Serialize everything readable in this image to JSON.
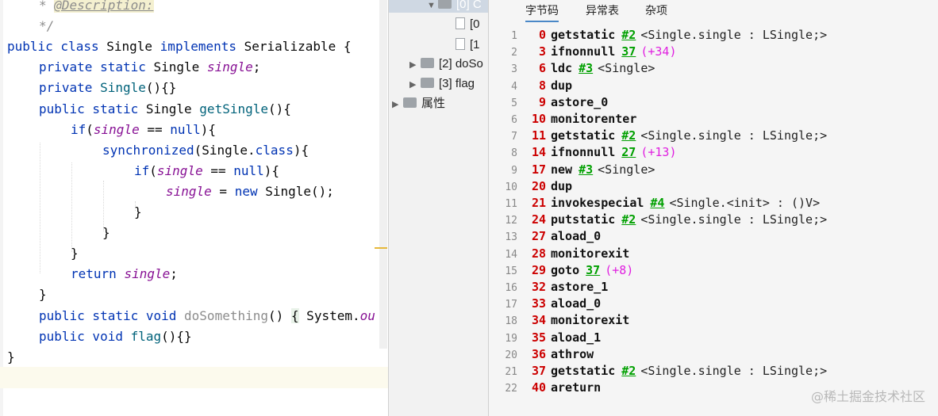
{
  "editor": {
    "lines": [
      {
        "indent": 1,
        "tokens": [
          [
            "cmt",
            "* "
          ],
          [
            "tag",
            "@Description:"
          ]
        ]
      },
      {
        "indent": 1,
        "tokens": [
          [
            "cmt",
            "*/"
          ]
        ]
      },
      {
        "indent": 0,
        "tokens": [
          [
            "kw",
            "public class "
          ],
          [
            "plain",
            "Single "
          ],
          [
            "kw",
            "implements "
          ],
          [
            "plain",
            "Serializable {"
          ]
        ]
      },
      {
        "indent": 1,
        "tokens": [
          [
            "kw",
            "private static "
          ],
          [
            "plain",
            "Single "
          ],
          [
            "fld",
            "single"
          ],
          [
            "plain",
            ";"
          ]
        ]
      },
      {
        "indent": 1,
        "tokens": [
          [
            "kw",
            "private "
          ],
          [
            "mth",
            "Single"
          ],
          [
            "plain",
            "(){}"
          ]
        ]
      },
      {
        "indent": 1,
        "tokens": [
          [
            "kw",
            "public static "
          ],
          [
            "plain",
            "Single "
          ],
          [
            "mth",
            "getSingle"
          ],
          [
            "plain",
            "(){"
          ]
        ]
      },
      {
        "indent": 2,
        "tokens": [
          [
            "kw",
            "if"
          ],
          [
            "plain",
            "("
          ],
          [
            "fld",
            "single"
          ],
          [
            "plain",
            " == "
          ],
          [
            "kw",
            "null"
          ],
          [
            "plain",
            "){"
          ]
        ]
      },
      {
        "indent": 3,
        "tokens": [
          [
            "kw",
            "synchronized"
          ],
          [
            "plain",
            "(Single."
          ],
          [
            "kw",
            "class"
          ],
          [
            "plain",
            "){"
          ]
        ]
      },
      {
        "indent": 4,
        "tokens": [
          [
            "kw",
            "if"
          ],
          [
            "plain",
            "("
          ],
          [
            "fld",
            "single"
          ],
          [
            "plain",
            " == "
          ],
          [
            "kw",
            "null"
          ],
          [
            "plain",
            "){"
          ]
        ]
      },
      {
        "indent": 5,
        "tokens": [
          [
            "fld",
            "single"
          ],
          [
            "plain",
            " = "
          ],
          [
            "kw",
            "new "
          ],
          [
            "plain",
            "Single();"
          ]
        ]
      },
      {
        "indent": 4,
        "tokens": [
          [
            "plain",
            "}"
          ]
        ]
      },
      {
        "indent": 3,
        "tokens": [
          [
            "plain",
            "}"
          ]
        ]
      },
      {
        "indent": 2,
        "tokens": [
          [
            "plain",
            "}"
          ]
        ]
      },
      {
        "indent": 2,
        "tokens": [
          [
            "kw",
            "return "
          ],
          [
            "fld",
            "single"
          ],
          [
            "plain",
            ";"
          ]
        ]
      },
      {
        "indent": 1,
        "tokens": [
          [
            "plain",
            "}"
          ]
        ]
      },
      {
        "indent": 1,
        "tokens": [
          [
            "kw",
            "public static void "
          ],
          [
            "dim",
            "doSomething"
          ],
          [
            "plain",
            "() "
          ],
          [
            "fold",
            "{"
          ],
          [
            "plain",
            " System."
          ],
          [
            "fld",
            "ou"
          ]
        ]
      },
      {
        "indent": 1,
        "tokens": [
          [
            "kw",
            "public void "
          ],
          [
            "mth",
            "flag"
          ],
          [
            "plain",
            "(){}"
          ]
        ]
      },
      {
        "indent": 0,
        "tokens": [
          [
            "plain",
            "}"
          ]
        ]
      }
    ]
  },
  "tree": {
    "rows": [
      {
        "kind": "folder",
        "arrow": "▼",
        "label": "[0] C",
        "depth": 2,
        "selected": true
      },
      {
        "kind": "file",
        "arrow": "",
        "label": "[0",
        "depth": 3
      },
      {
        "kind": "file",
        "arrow": "",
        "label": "[1",
        "depth": 3
      },
      {
        "kind": "folder",
        "arrow": "▶",
        "label": "[2] doSo",
        "depth": 1
      },
      {
        "kind": "folder",
        "arrow": "▶",
        "label": "[3] flag",
        "depth": 1
      },
      {
        "kind": "folder",
        "arrow": "▶",
        "label": "属性",
        "depth": 0
      }
    ]
  },
  "bytecode": {
    "tabs": [
      "字节码",
      "异常表",
      "杂项"
    ],
    "active_tab": 0,
    "lines": [
      {
        "n": "1",
        "off": "0",
        "op": "getstatic",
        "ref": "#2",
        "desc": "<Single.single : LSingle;>"
      },
      {
        "n": "2",
        "off": "3",
        "op": "ifnonnull",
        "ref": "37",
        "rel": "(+34)"
      },
      {
        "n": "3",
        "off": "6",
        "op": "ldc",
        "ref": "#3",
        "desc": "<Single>"
      },
      {
        "n": "4",
        "off": "8",
        "op": "dup"
      },
      {
        "n": "5",
        "off": "9",
        "op": "astore_0"
      },
      {
        "n": "6",
        "off": "10",
        "op": "monitorenter"
      },
      {
        "n": "7",
        "off": "11",
        "op": "getstatic",
        "ref": "#2",
        "desc": "<Single.single : LSingle;>"
      },
      {
        "n": "8",
        "off": "14",
        "op": "ifnonnull",
        "ref": "27",
        "rel": "(+13)"
      },
      {
        "n": "9",
        "off": "17",
        "op": "new",
        "ref": "#3",
        "desc": "<Single>"
      },
      {
        "n": "10",
        "off": "20",
        "op": "dup"
      },
      {
        "n": "11",
        "off": "21",
        "op": "invokespecial",
        "ref": "#4",
        "desc": "<Single.<init> : ()V>"
      },
      {
        "n": "12",
        "off": "24",
        "op": "putstatic",
        "ref": "#2",
        "desc": "<Single.single : LSingle;>"
      },
      {
        "n": "13",
        "off": "27",
        "op": "aload_0"
      },
      {
        "n": "14",
        "off": "28",
        "op": "monitorexit"
      },
      {
        "n": "15",
        "off": "29",
        "op": "goto",
        "ref": "37",
        "rel": "(+8)"
      },
      {
        "n": "16",
        "off": "32",
        "op": "astore_1"
      },
      {
        "n": "17",
        "off": "33",
        "op": "aload_0"
      },
      {
        "n": "18",
        "off": "34",
        "op": "monitorexit"
      },
      {
        "n": "19",
        "off": "35",
        "op": "aload_1"
      },
      {
        "n": "20",
        "off": "36",
        "op": "athrow"
      },
      {
        "n": "21",
        "off": "37",
        "op": "getstatic",
        "ref": "#2",
        "desc": "<Single.single : LSingle;>"
      },
      {
        "n": "22",
        "off": "40",
        "op": "areturn"
      }
    ]
  },
  "watermark": "@稀土掘金技术社区"
}
